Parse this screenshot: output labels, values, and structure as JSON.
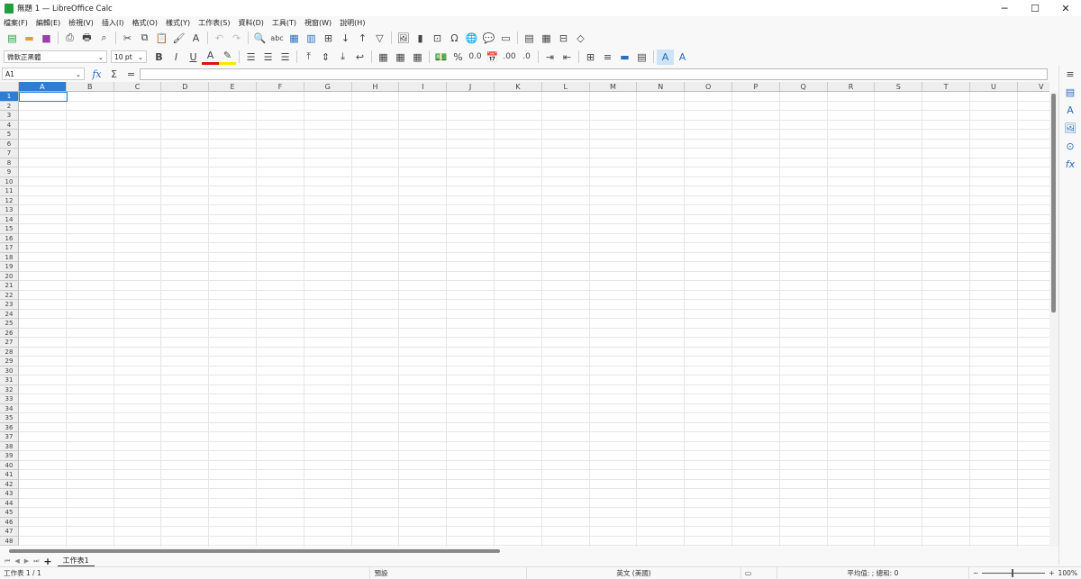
{
  "window": {
    "title": "無題 1 — LibreOffice Calc",
    "minimize": "─",
    "maximize": "☐",
    "close": "✕"
  },
  "menu": [
    "檔案(F)",
    "編輯(E)",
    "檢視(V)",
    "插入(I)",
    "格式(O)",
    "樣式(Y)",
    "工作表(S)",
    "資料(D)",
    "工具(T)",
    "視窗(W)",
    "說明(H)"
  ],
  "toolbar": {
    "font_name": "微軟正黑體",
    "font_size": "10 pt",
    "bold": "B",
    "italic": "I",
    "underline": "U",
    "font_color": "#d11",
    "highlight_color": "#ffe600"
  },
  "formula": {
    "name_box": "A1",
    "fx": "fx",
    "sum": "Σ",
    "equals": "=",
    "value": ""
  },
  "columns": [
    "A",
    "B",
    "C",
    "D",
    "E",
    "F",
    "G",
    "H",
    "I",
    "J",
    "K",
    "L",
    "M",
    "N",
    "O",
    "P",
    "Q",
    "R",
    "S",
    "T",
    "U",
    "V"
  ],
  "row_count": 48,
  "active_cell": "A1",
  "sheets": {
    "add": "+",
    "tabs": [
      "工作表1"
    ]
  },
  "status": {
    "sheet": "工作表 1 / 1",
    "style": "預設",
    "language": "英文 (美國)",
    "summary": "平均值: ; 總和: 0",
    "zoom": "100%",
    "zoom_minus": "−",
    "zoom_plus": "+"
  }
}
